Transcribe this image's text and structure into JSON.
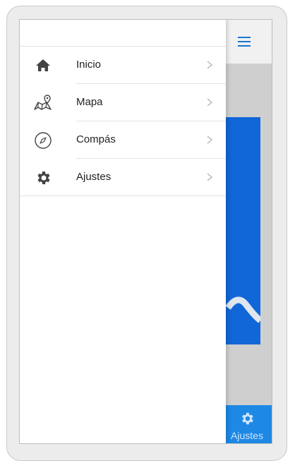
{
  "menu": {
    "items": [
      {
        "label": "Inicio",
        "icon": "home-icon"
      },
      {
        "label": "Mapa",
        "icon": "map-pin-icon"
      },
      {
        "label": "Compás",
        "icon": "compass-icon"
      },
      {
        "label": "Ajustes",
        "icon": "gear-icon"
      }
    ]
  },
  "bottom_nav": {
    "settings_label": "Ajustes"
  },
  "colors": {
    "accent": "#1e88e5",
    "card": "#1167d8",
    "menu_icon": "#1976d2"
  }
}
